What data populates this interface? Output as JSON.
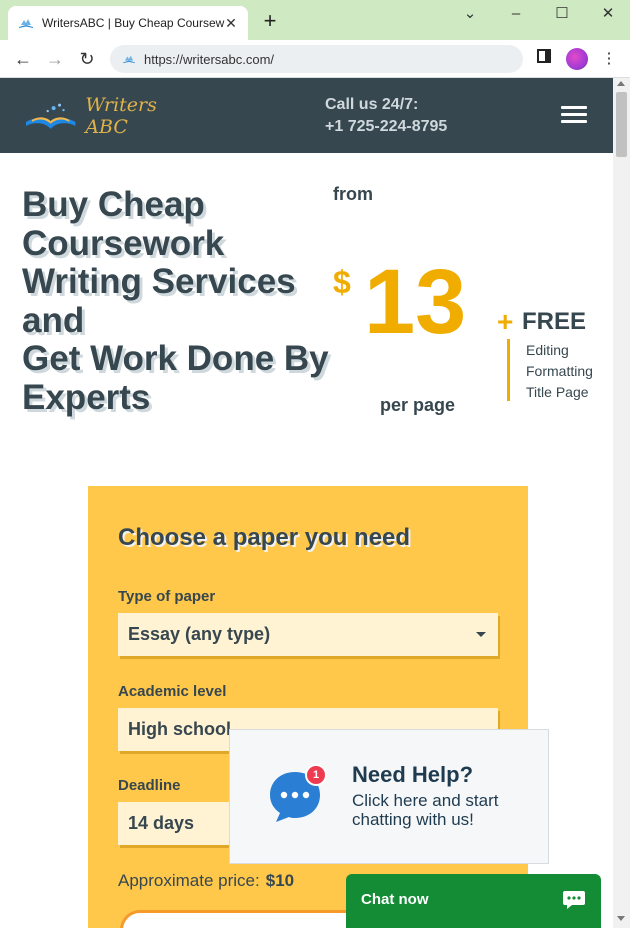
{
  "browser": {
    "tab_title": "WritersABC | Buy Cheap Coursew",
    "url": "https://writersabc.com/",
    "new_tab": "+",
    "close_tab": "✕"
  },
  "header": {
    "logo_text": "Writers ABC",
    "call_line1": "Call us 24/7:",
    "call_line2": "+1 725-224-8795"
  },
  "hero": {
    "title_lines": [
      "Buy Cheap",
      "Coursework",
      "Writing Services",
      "and",
      "Get Work Done By",
      "Experts"
    ],
    "from": "from",
    "currency": "$",
    "price": "13",
    "per_page": "per page",
    "plus": "+",
    "free": "FREE",
    "free_items": [
      "Editing",
      "Formatting",
      "Title Page"
    ]
  },
  "form": {
    "title": "Choose a paper you need",
    "type_label": "Type of paper",
    "type_value": "Essay (any type)",
    "level_label": "Academic level",
    "level_value": "High school",
    "deadline_label": "Deadline",
    "deadline_value": "14 days",
    "approx_label": "Approximate price:",
    "approx_value": "$10"
  },
  "help": {
    "badge": "1",
    "title": "Need Help?",
    "text": "Click here and start chatting with us!"
  },
  "chat": {
    "label": "Chat now"
  },
  "colors": {
    "accent": "#f0ad00",
    "header_bg": "#37474f",
    "form_bg": "#ffc84a",
    "chat_bg": "#138c35",
    "badge": "#ef3b4f"
  }
}
